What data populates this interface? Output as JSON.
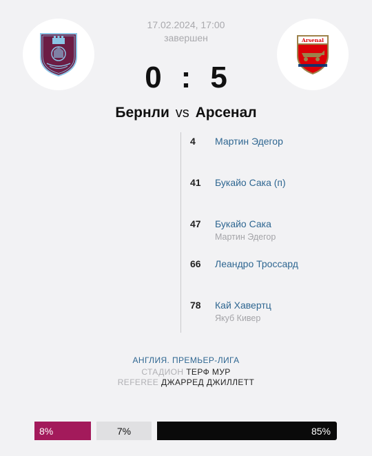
{
  "match": {
    "datetime": "17.02.2024, 17:00",
    "status": "завершен",
    "score_home": "0",
    "score_sep": ":",
    "score_away": "5",
    "home_team": "Бернли",
    "vs": "vs",
    "away_team": "Арсенал"
  },
  "crests": {
    "home_icon": "burnley-crest",
    "away_icon": "arsenal-crest",
    "away_crest_text": "Arsenal",
    "home_color": "#6c1d45",
    "away_color": "#db0007"
  },
  "goals": [
    {
      "minute": "4",
      "scorer": "Мартин Эдегор",
      "assist": ""
    },
    {
      "minute": "41",
      "scorer": "Букайо Сака (п)",
      "assist": ""
    },
    {
      "minute": "47",
      "scorer": "Букайо Сака",
      "assist": "Мартин Эдегор"
    },
    {
      "minute": "66",
      "scorer": "Леандро Троссард",
      "assist": ""
    },
    {
      "minute": "78",
      "scorer": "Кай Хавертц",
      "assist": "Якуб Кивер"
    }
  ],
  "info": {
    "league": "АНГЛИЯ. ПРЕМЬЕР-ЛИГА",
    "stadium_label": "СТАДИОН",
    "stadium_value": "ТЕРФ МУР",
    "referee_label": "REFEREE",
    "referee_value": "ДЖАРРЕД ДЖИЛЛЕТТ"
  },
  "odds": {
    "home": "8%",
    "draw": "7%",
    "away": "85%",
    "home_share": 0.08,
    "draw_share": 0.07,
    "away_share": 0.85,
    "home_color": "#a31a5b",
    "draw_color": "#e0e0e2",
    "away_color": "#0a0a0a"
  }
}
